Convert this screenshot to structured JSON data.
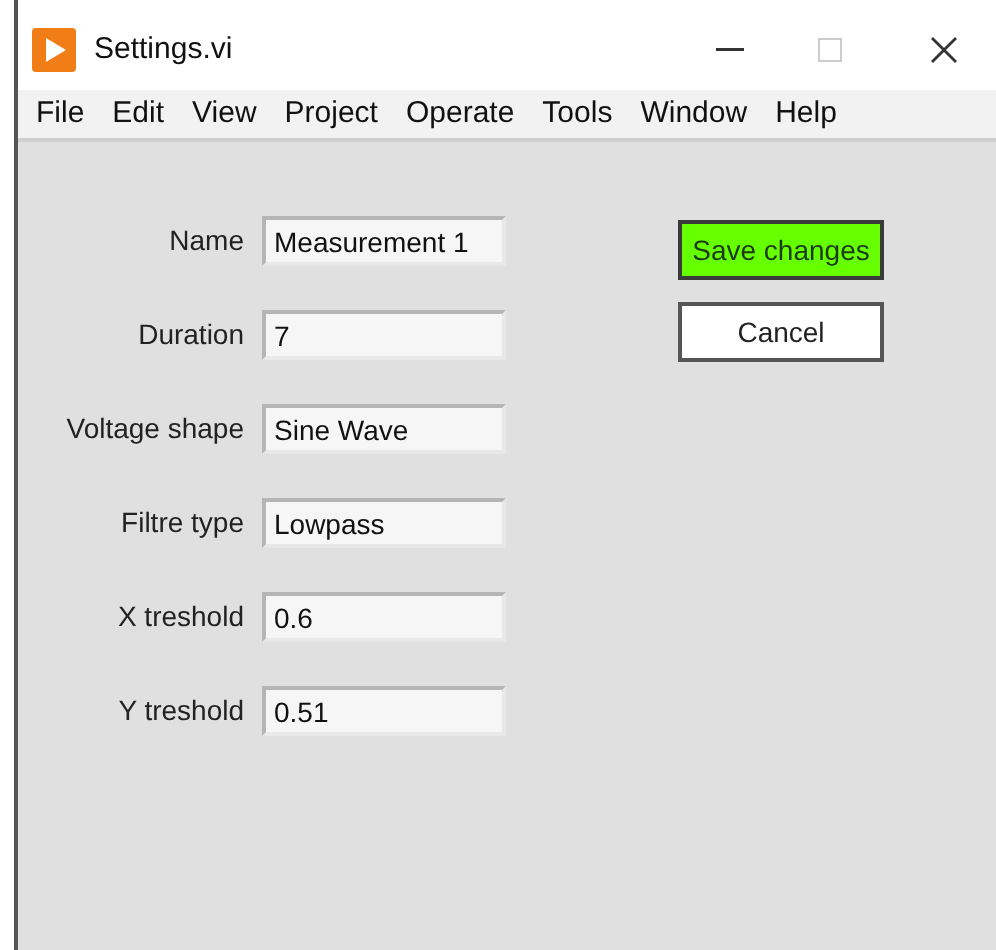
{
  "window": {
    "title": "Settings.vi"
  },
  "menu": [
    "File",
    "Edit",
    "View",
    "Project",
    "Operate",
    "Tools",
    "Window",
    "Help"
  ],
  "fields": [
    {
      "label": "Name",
      "value": "Measurement 1"
    },
    {
      "label": "Duration",
      "value": "7"
    },
    {
      "label": "Voltage shape",
      "value": "Sine Wave"
    },
    {
      "label": "Filtre type",
      "value": "Lowpass"
    },
    {
      "label": "X treshold",
      "value": "0.6"
    },
    {
      "label": "Y treshold",
      "value": "0.51"
    }
  ],
  "buttons": [
    {
      "label": "Save changes",
      "kind": "primary"
    },
    {
      "label": "Cancel",
      "kind": "default"
    }
  ]
}
